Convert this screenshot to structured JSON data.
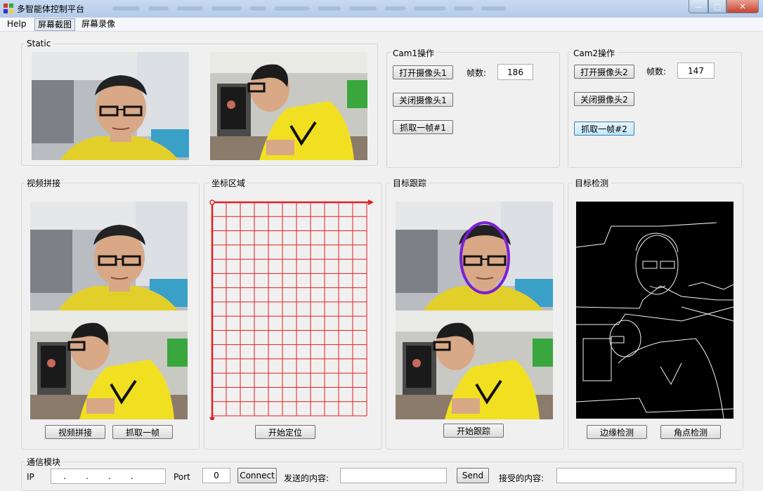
{
  "window": {
    "title": "多智能体控制平台"
  },
  "menu": {
    "items": [
      "Help",
      "屏幕截图",
      "屏幕录像"
    ]
  },
  "static_group": {
    "label": "Static"
  },
  "cam1": {
    "label": "Cam1操作",
    "open": "打开摄像头1",
    "close": "关闭摄像头1",
    "grab": "抓取一帧#1",
    "frame_label": "帧数:",
    "frame_value": "186"
  },
  "cam2": {
    "label": "Cam2操作",
    "open": "打开摄像头2",
    "close": "关闭摄像头2",
    "grab": "抓取一帧#2",
    "frame_label": "帧数:",
    "frame_value": "147"
  },
  "stitch": {
    "label": "视频拼接",
    "btn_stitch": "视频拼接",
    "btn_grab": "抓取一帧"
  },
  "coords": {
    "label": "坐标区域",
    "btn_start": "开始定位"
  },
  "tracking": {
    "label": "目标跟踪",
    "btn_start": "开始跟踪"
  },
  "detect": {
    "label": "目标检测",
    "btn_edge": "边缘检测",
    "btn_corner": "角点检测"
  },
  "comm": {
    "label": "通信模块",
    "ip_label": "IP",
    "port_label": "Port",
    "port_value": "0",
    "connect_btn": "Connect",
    "send_label": "发送的内容:",
    "send_btn": "Send",
    "recv_label": "接受的内容:"
  },
  "colors": {
    "grid": "#e02020",
    "track_ellipse": "#7a1fd6",
    "shirt": "#e8d21e"
  }
}
